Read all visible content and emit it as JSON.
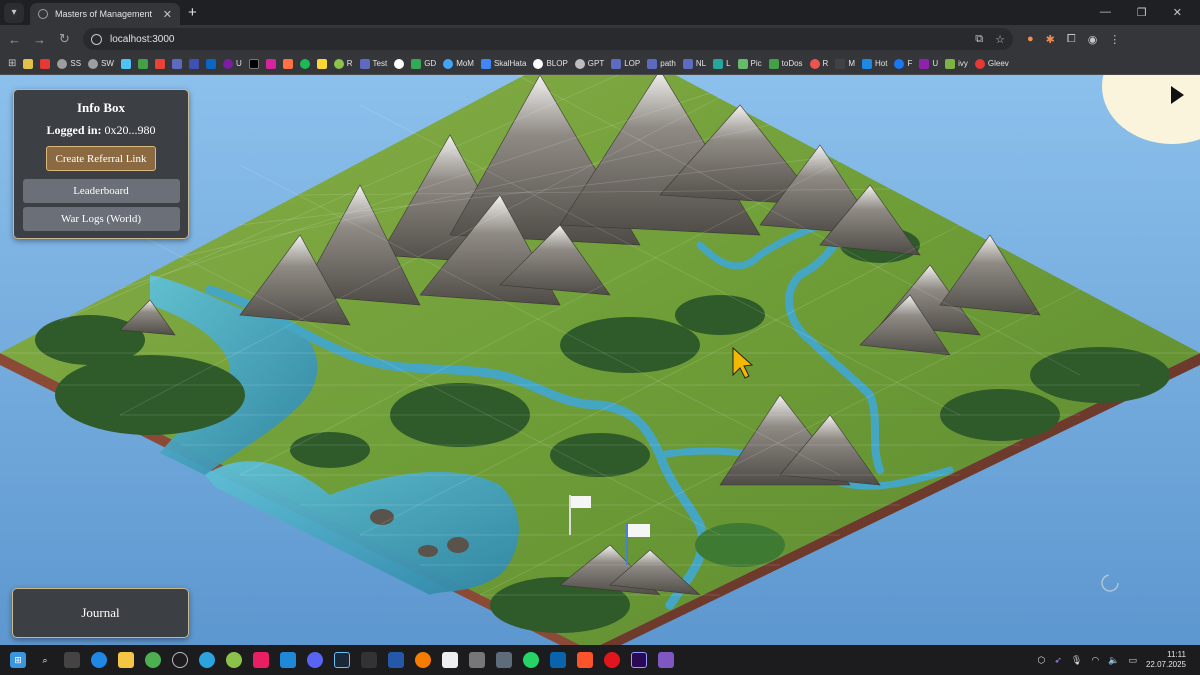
{
  "browser": {
    "tab_title": "Masters of Management",
    "url": "localhost:3000",
    "bookmarks": [
      "SS",
      "SW",
      "U",
      "R",
      "Test",
      "GD",
      "MoM",
      "SkalHata",
      "BLOP",
      "GPT",
      "LOP",
      "path",
      "NL",
      "L",
      "Pic",
      "toDos",
      "R",
      "M",
      "Hot",
      "F",
      "U",
      "ivy",
      "Gleev"
    ]
  },
  "info_box": {
    "title": "Info Box",
    "logged_in_label": "Logged in:",
    "account": "0x20...980",
    "referral_button": "Create Referral Link",
    "leaderboard_button": "Leaderboard",
    "warlogs_button": "War Logs (World)"
  },
  "journal": {
    "label": "Journal"
  },
  "taskbar": {
    "time": "11:11",
    "date": "22.07.2025"
  },
  "colors": {
    "sky": "#79b0e0",
    "panel_bg": "#3c3f43",
    "panel_border": "#c9b98f",
    "referral_bg": "#8b6a42",
    "gray_button": "#6b7078",
    "grass": "#6e9f3a",
    "water": "#3f9fbf",
    "mountain": "#6a6660",
    "forest": "#2f5a2a",
    "sun": "#fbf4dc"
  }
}
